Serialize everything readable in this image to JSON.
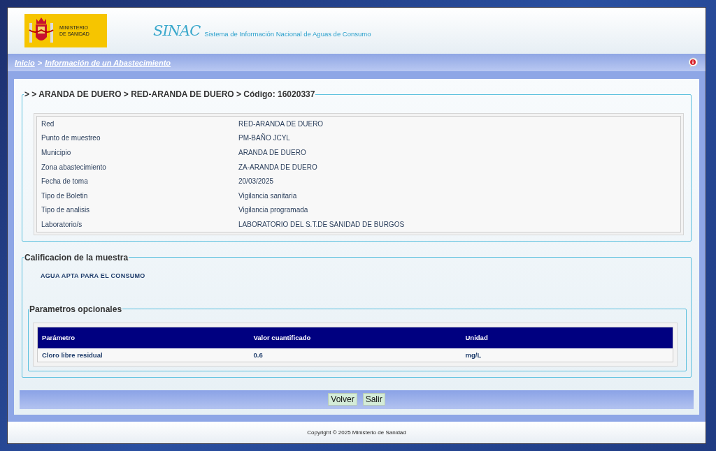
{
  "header": {
    "logo_text": [
      "MINISTERIO",
      "DE SANIDAD"
    ],
    "brand": "SINAC",
    "subtitle": "Sistema de Información Nacional de Aguas de Consumo"
  },
  "breadcrumb": [
    {
      "label": "Inicio",
      "kind": "link"
    },
    {
      "label": ">",
      "kind": "separator"
    },
    {
      "label": "Información de un Abastecimiento",
      "kind": "link"
    }
  ],
  "details": {
    "legend": "> > ARANDA DE DUERO > RED-ARANDA DE DUERO > Código: 16020337",
    "rows": [
      {
        "label": "Red",
        "value": "RED-ARANDA DE DUERO"
      },
      {
        "label": "Punto de muestreo",
        "value": "PM-BAÑO JCYL"
      },
      {
        "label": "Municipio",
        "value": "ARANDA DE DUERO"
      },
      {
        "label": "Zona abastecimiento",
        "value": "ZA-ARANDA DE DUERO"
      },
      {
        "label": "Fecha de toma",
        "value": "20/03/2025"
      },
      {
        "label": "Tipo de Boletin",
        "value": "Vigilancia sanitaria"
      },
      {
        "label": "Tipo de analisis",
        "value": "Vigilancia programada"
      },
      {
        "label": "Laboratorio/s",
        "value": "LABORATORIO DEL S.T.DE SANIDAD DE BURGOS"
      }
    ]
  },
  "qualification": {
    "legend": "Calificacion de la muestra",
    "result": "AGUA APTA PARA EL CONSUMO",
    "optional": {
      "legend": "Parametros opcionales",
      "columns": [
        "Parámetro",
        "Valor cuantificado",
        "Unidad"
      ],
      "rows": [
        [
          "Cloro libre residual",
          "0.6",
          "mg/L"
        ]
      ]
    }
  },
  "buttons": [
    "Volver",
    "Salir"
  ],
  "footer": "Copyright © 2025 Ministerio de Sanidad"
}
